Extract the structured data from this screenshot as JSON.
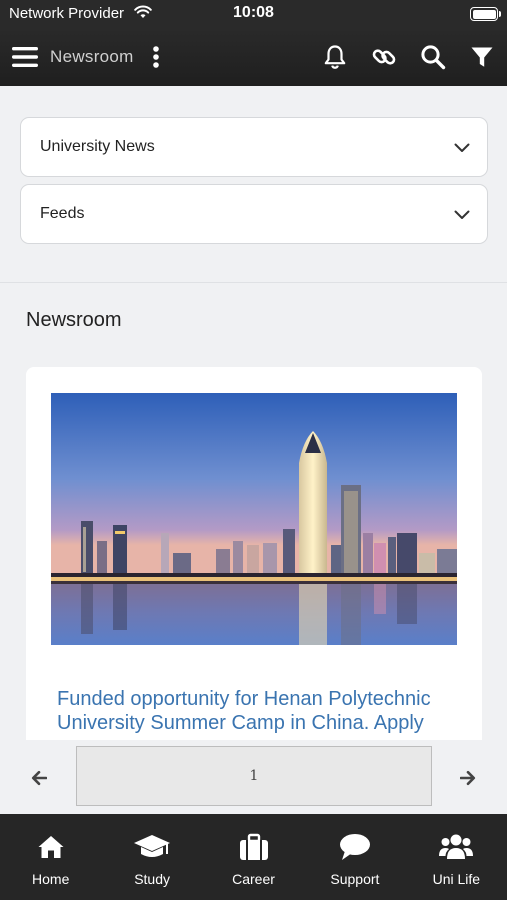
{
  "status_bar": {
    "provider": "Network Provider",
    "time": "10:08"
  },
  "header": {
    "title": "Newsroom",
    "icons": [
      "menu-icon",
      "more-vertical-icon",
      "bell-icon",
      "link-icon",
      "search-icon",
      "filter-icon"
    ]
  },
  "selects": {
    "category": {
      "value": "University News"
    },
    "feed": {
      "value": "Feeds"
    }
  },
  "section": {
    "title": "Newsroom"
  },
  "news": [
    {
      "headline": "Funded opportunity for Henan Polytechnic University Summer Camp in China. Apply",
      "image_icon": "city-skyline-photo"
    }
  ],
  "pager": {
    "page": "1"
  },
  "tabs": [
    {
      "label": "Home",
      "icon": "home-icon"
    },
    {
      "label": "Study",
      "icon": "graduation-cap-icon"
    },
    {
      "label": "Career",
      "icon": "briefcase-icon"
    },
    {
      "label": "Support",
      "icon": "chat-bubble-icon"
    },
    {
      "label": "Uni Life",
      "icon": "users-icon"
    }
  ],
  "colors": {
    "header_bg": "#2a2a2a",
    "tab_bar_bg": "#262626",
    "page_bg": "#f0f1f3",
    "link_blue": "#3a74b0"
  }
}
